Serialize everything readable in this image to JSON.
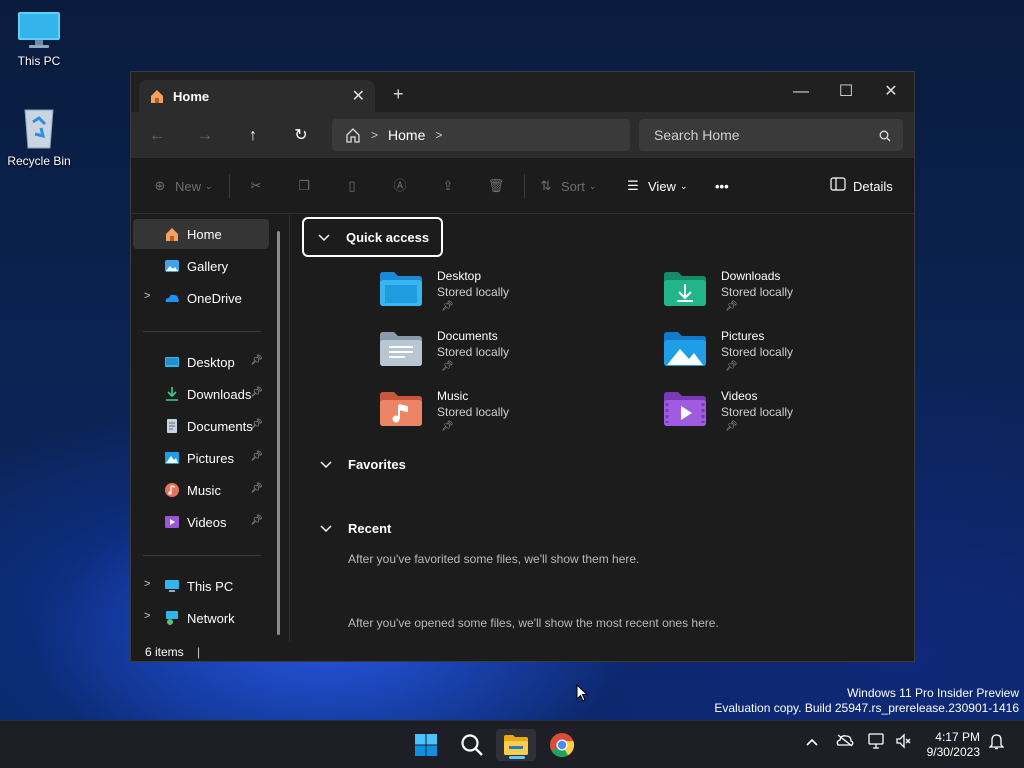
{
  "desktop": {
    "icons": [
      {
        "label": "This PC",
        "icon": "monitor-icon"
      },
      {
        "label": "Recycle Bin",
        "icon": "recycle-bin-icon"
      }
    ],
    "watermark": {
      "line1": "Windows 11 Pro Insider Preview",
      "line2": "Evaluation copy. Build 25947.rs_prerelease.230901-1416"
    }
  },
  "explorer": {
    "tab_title": "Home",
    "tab_close": "✕",
    "new_tab": "+",
    "window_controls": {
      "minimize": "—",
      "maximize": "☐",
      "close": "✕"
    },
    "breadcrumb": {
      "current": "Home"
    },
    "search": {
      "placeholder": "Search Home"
    },
    "commands": {
      "new": "New",
      "sort": "Sort",
      "view": "View",
      "more": "•••",
      "details": "Details"
    },
    "sidebar": {
      "top": [
        {
          "label": "Home",
          "selected": true,
          "icon": "home-icon"
        },
        {
          "label": "Gallery",
          "icon": "gallery-icon"
        },
        {
          "label": "OneDrive",
          "icon": "onedrive-icon",
          "expandable": true
        }
      ],
      "pinned": [
        {
          "label": "Desktop",
          "icon": "desktop-folder-icon"
        },
        {
          "label": "Downloads",
          "icon": "downloads-icon"
        },
        {
          "label": "Documents",
          "icon": "documents-icon"
        },
        {
          "label": "Pictures",
          "icon": "pictures-icon"
        },
        {
          "label": "Music",
          "icon": "music-icon"
        },
        {
          "label": "Videos",
          "icon": "videos-icon"
        }
      ],
      "bottom": [
        {
          "label": "This PC",
          "icon": "this-pc-icon"
        },
        {
          "label": "Network",
          "icon": "network-icon"
        }
      ]
    },
    "quick_access": {
      "heading": "Quick access",
      "items": [
        {
          "name": "Desktop",
          "sub": "Stored locally"
        },
        {
          "name": "Downloads",
          "sub": "Stored locally"
        },
        {
          "name": "Documents",
          "sub": "Stored locally"
        },
        {
          "name": "Pictures",
          "sub": "Stored locally"
        },
        {
          "name": "Music",
          "sub": "Stored locally"
        },
        {
          "name": "Videos",
          "sub": "Stored locally"
        }
      ]
    },
    "favorites": {
      "heading": "Favorites",
      "hint": "After you've favorited some files, we'll show them here."
    },
    "recent": {
      "heading": "Recent",
      "hint": "After you've opened some files, we'll show the most recent ones here."
    },
    "status": "6 items"
  },
  "taskbar": {
    "time": "4:17 PM",
    "date": "9/30/2023"
  },
  "colors": {
    "accent": "#60cdff",
    "window_bg": "#1c1c1c",
    "taskbar_bg": "#1e1f26"
  }
}
